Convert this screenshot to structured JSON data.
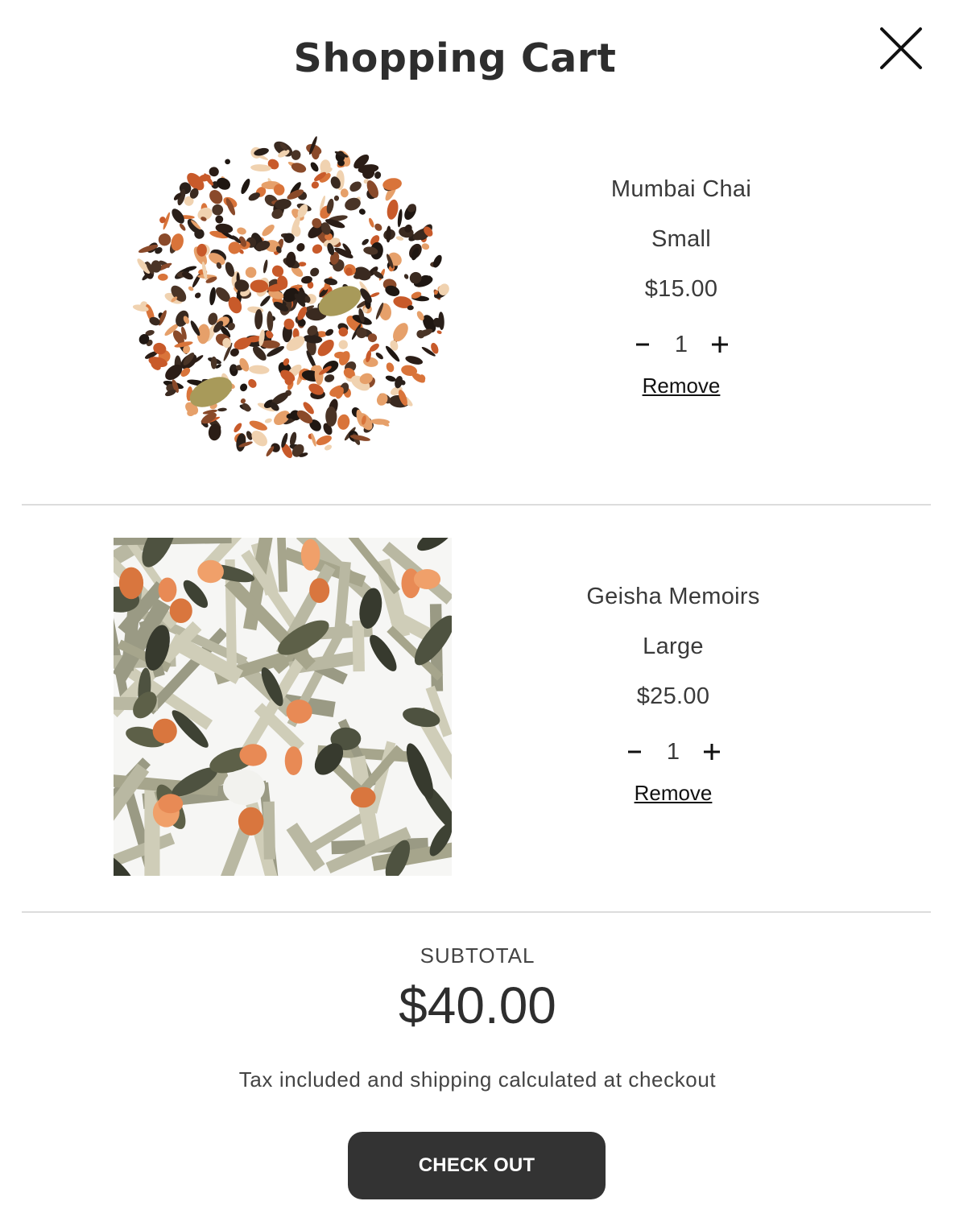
{
  "header": {
    "title": "Shopping Cart",
    "close_icon": "close-icon"
  },
  "items": [
    {
      "name": "Mumbai Chai",
      "variant": "Small",
      "price": "$15.00",
      "quantity": "1",
      "remove_label": "Remove",
      "image": "loose-leaf-chai-tea-image"
    },
    {
      "name": "Geisha Memoirs",
      "variant": "Large",
      "price": "$25.00",
      "quantity": "1",
      "remove_label": "Remove",
      "image": "loose-leaf-green-tea-image"
    }
  ],
  "summary": {
    "subtotal_label": "SUBTOTAL",
    "subtotal_value": "$40.00",
    "tax_note": "Tax included and shipping calculated at checkout",
    "checkout_label": "CHECK OUT"
  },
  "colors": {
    "button_bg": "#333333",
    "text": "#333333",
    "divider": "#dcdcdc"
  }
}
